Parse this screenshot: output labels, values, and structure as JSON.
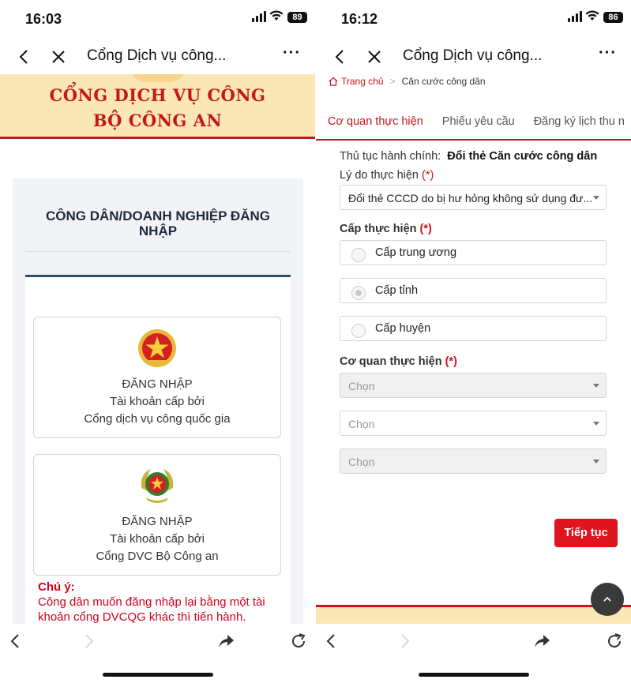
{
  "left": {
    "status": {
      "time": "16:03",
      "battery": "89"
    },
    "nav": {
      "title": "Cổng Dịch vụ công..."
    },
    "banner": {
      "line1": "CỔNG DỊCH VỤ CÔNG",
      "line2": "BỘ CÔNG AN"
    },
    "login": {
      "heading": "CÔNG DÂN/DOANH NGHIỆP ĐĂNG NHẬP",
      "cards": [
        {
          "l1": "ĐĂNG NHẬP",
          "l2": "Tài khoản cấp bởi",
          "l3": "Cổng dịch vụ công quốc gia"
        },
        {
          "l1": "ĐĂNG NHẬP",
          "l2": "Tài khoản cấp bởi",
          "l3": "Cổng DVC Bộ Công an"
        }
      ],
      "note_title": "Chú ý:",
      "note_text": "Công dân muốn đăng nhập lại bằng một tài khoản cổng DVCQG khác thì tiến hành."
    }
  },
  "right": {
    "status": {
      "time": "16:12",
      "battery": "86"
    },
    "nav": {
      "title": "Cổng Dịch vụ công..."
    },
    "breadcrumb": {
      "home": "Trang chủ",
      "current": "Căn cước công dân"
    },
    "tabs": [
      "Cơ quan thực hiện",
      "Phiếu yêu cầu",
      "Đăng ký lịch thu n"
    ],
    "form": {
      "procedure_label": "Thủ tục hành chính:",
      "procedure_value": "Đổi thẻ Căn cước công dân",
      "reason_label": "Lý do thực hiện",
      "required_mark": "(*)",
      "reason_value": "Đổi thẻ CCCD do bị hư hỏng không sử dụng đư...",
      "level_label": "Cấp thực hiện",
      "levels": [
        "Cấp trung ương",
        "Cấp tỉnh",
        "Cấp huyện"
      ],
      "selected_level": "Cấp tỉnh",
      "agency_label": "Cơ quan thực hiện",
      "agency_selects": [
        "Chọn",
        "Chọn",
        "Chọn"
      ]
    },
    "continue_button": "Tiếp tục"
  }
}
